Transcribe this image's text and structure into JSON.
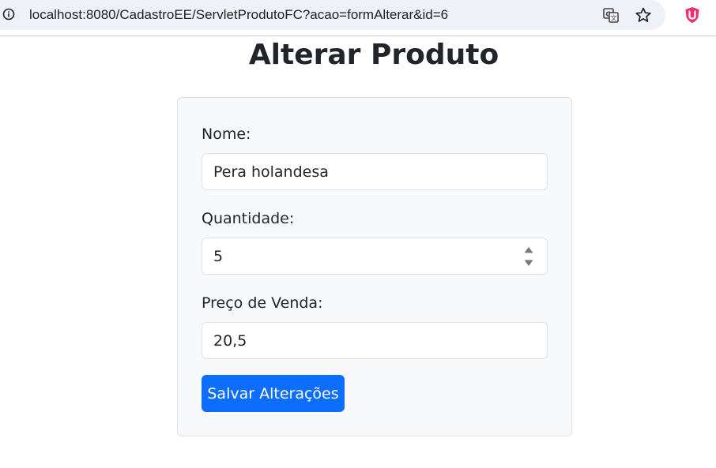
{
  "browser": {
    "url": "localhost:8080/CadastroEE/ServletProdutoFC?acao=formAlterar&id=6"
  },
  "page": {
    "title": "Alterar Produto"
  },
  "form": {
    "nome_label": "Nome:",
    "nome_value": "Pera holandesa",
    "quantidade_label": "Quantidade:",
    "quantidade_value": "5",
    "preco_label": "Preço de Venda:",
    "preco_value": "20,5",
    "submit_label": "Salvar Alterações"
  },
  "colors": {
    "primary": "#0d6efd",
    "card_bg": "#f8f9fa",
    "extension_icon": "#e8336d"
  },
  "icons": {
    "site_info": "info-icon",
    "translate": "translate-icon",
    "bookmark": "star-icon",
    "extension": "shield-extension-icon"
  }
}
